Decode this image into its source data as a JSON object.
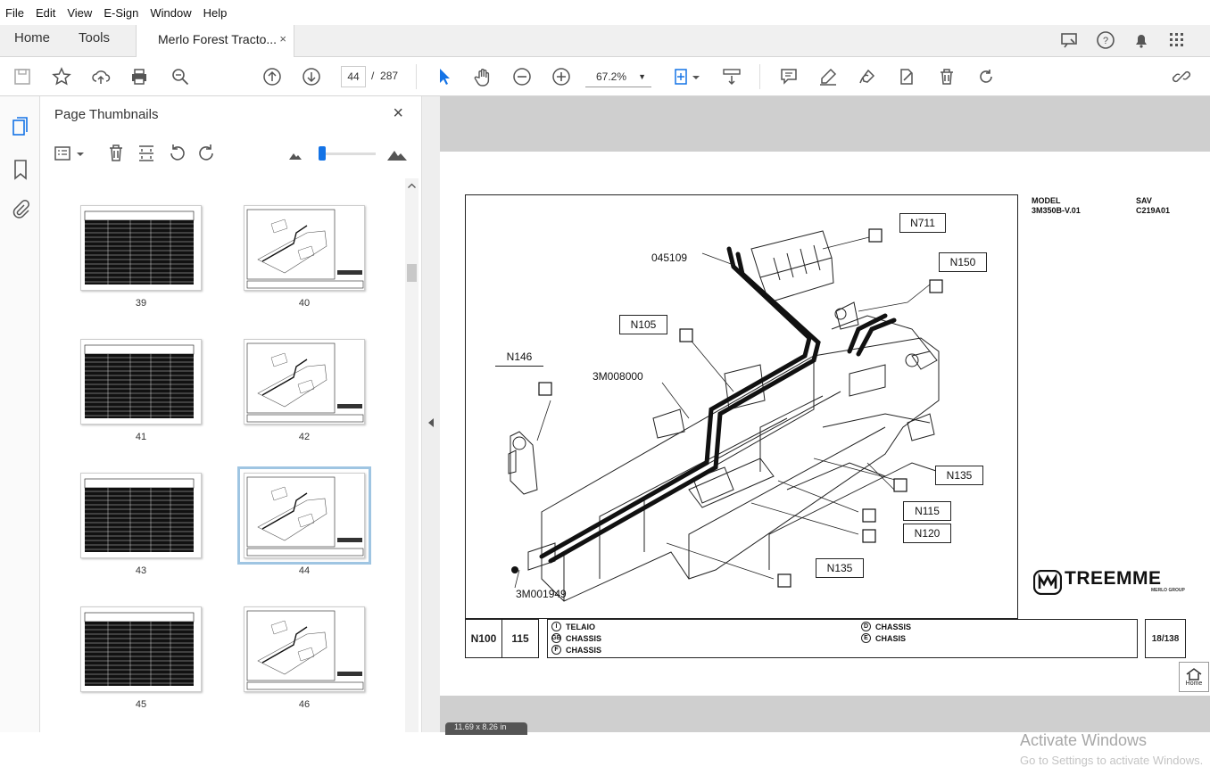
{
  "menu": [
    "File",
    "Edit",
    "View",
    "E-Sign",
    "Window",
    "Help"
  ],
  "tabs": {
    "home": "Home",
    "tools": "Tools",
    "document": "Merlo Forest Tracto...",
    "close": "×"
  },
  "toolbar": {
    "page_current": "44",
    "page_sep": "/",
    "page_total": "287",
    "zoom": "67.2%"
  },
  "panel": {
    "title": "Page Thumbnails",
    "close": "×"
  },
  "thumbnails": [
    {
      "label": "39",
      "kind": "table"
    },
    {
      "label": "40",
      "kind": "drawing"
    },
    {
      "label": "41",
      "kind": "table"
    },
    {
      "label": "42",
      "kind": "drawing"
    },
    {
      "label": "43",
      "kind": "table"
    },
    {
      "label": "44",
      "kind": "drawing",
      "selected": true
    },
    {
      "label": "45",
      "kind": "table"
    },
    {
      "label": "46",
      "kind": "drawing"
    }
  ],
  "document": {
    "model_label": "MODEL",
    "model_value": "3M350B-V.01",
    "sav_label": "SAV",
    "sav_value": "C219A01",
    "brand": "TREEMME",
    "brand_sub": "MERLO GROUP",
    "callouts": [
      "N711",
      "N150",
      "N105",
      "N146",
      "N135",
      "N115",
      "N120",
      "N135"
    ],
    "part_labels": [
      "045109",
      "3M008000",
      "3M001949"
    ],
    "titleblock": {
      "code": "N100",
      "number": "115",
      "page": "18/138",
      "langs": [
        {
          "flag": "I",
          "text": "TELAIO"
        },
        {
          "flag": "GB",
          "text": "CHASSIS"
        },
        {
          "flag": "F",
          "text": "CHASSIS"
        },
        {
          "flag": "D",
          "text": "CHASSIS"
        },
        {
          "flag": "E",
          "text": "CHASIS"
        }
      ]
    }
  },
  "home_button": "Home",
  "status_text": "11.69 x 8.26 in",
  "watermark": {
    "line1": "Activate Windows",
    "line2": "Go to Settings to activate Windows."
  },
  "colors": {
    "accent": "#1473e6",
    "chrome_bg": "#f0f0f0",
    "doc_bg": "#cfcfcf"
  }
}
